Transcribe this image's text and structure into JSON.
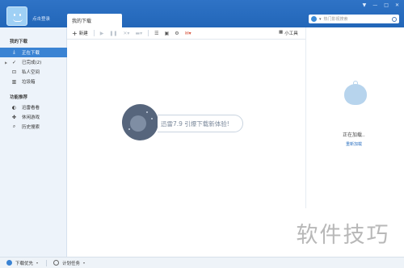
{
  "header": {
    "login_text": "点击登录",
    "tab_label": "我的下载",
    "search_placeholder": "热门影视搜索",
    "window_buttons": [
      "▼",
      "—",
      "□",
      "✕"
    ]
  },
  "sidebar": {
    "section1_title": "我的下载",
    "items1": [
      {
        "label": "正在下载",
        "icon": "download-icon",
        "glyph": "⤓"
      },
      {
        "label": "已完成(2)",
        "icon": "check-icon",
        "glyph": "✓"
      },
      {
        "label": "私人空间",
        "icon": "lock-icon",
        "glyph": "🔒"
      },
      {
        "label": "垃圾箱",
        "icon": "trash-icon",
        "glyph": "🗑"
      }
    ],
    "section2_title": "功能推荐",
    "items2": [
      {
        "label": "迅雷看看",
        "icon": "video-icon",
        "glyph": "◐"
      },
      {
        "label": "休闲游戏",
        "icon": "gamepad-icon",
        "glyph": "✤"
      },
      {
        "label": "历史搜索",
        "icon": "search-icon",
        "glyph": "⌕"
      }
    ]
  },
  "toolbar": {
    "new_label": "新建",
    "tools_label": "小工具"
  },
  "main": {
    "promo_text": "迅雷7.9 引爆下载新体验!"
  },
  "rightpanel": {
    "loading_text": "正在加载..",
    "reload_text": "重新加载"
  },
  "bottombar": {
    "download_priority": "下载优先",
    "scheduled_tasks": "计划任务"
  },
  "watermark": {
    "text": "软件技巧"
  },
  "colors": {
    "titlebar": "#2266b8",
    "active": "#3a83d3",
    "sidebar_bg": "#edf3fa"
  }
}
